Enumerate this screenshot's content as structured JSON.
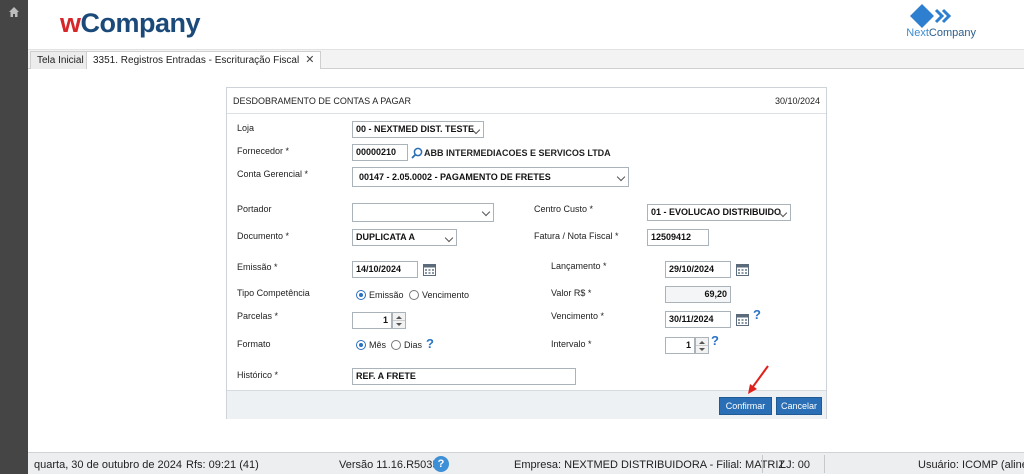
{
  "header": {
    "logo_w": "w",
    "logo_rest": "Company",
    "nc_next": "Next",
    "nc_company": "Company"
  },
  "tabs": [
    {
      "label": "Tela Inicial"
    },
    {
      "label": "3351. Registros Entradas - Escrituração Fiscal",
      "close": "✕"
    }
  ],
  "dialog": {
    "title": "DESDOBRAMENTO DE CONTAS A PAGAR",
    "date": "30/10/2024",
    "loja": {
      "label": "Loja",
      "value": "00 - NEXTMED DIST. TESTE"
    },
    "fornecedor": {
      "label": "Fornecedor *",
      "code": "00000210",
      "name": "ABB INTERMEDIACOES E SERVICOS LTDA"
    },
    "conta": {
      "label": "Conta Gerencial *",
      "value": "00147 - 2.05.0002 - PAGAMENTO DE FRETES"
    },
    "portador": {
      "label": "Portador",
      "value": ""
    },
    "centro_custo": {
      "label": "Centro Custo *",
      "value": "01 - EVOLUCAO DISTRIBUIDO"
    },
    "documento": {
      "label": "Documento *",
      "value": "DUPLICATA A"
    },
    "fatura": {
      "label": "Fatura / Nota Fiscal *",
      "value": "12509412"
    },
    "emissao": {
      "label": "Emissão *",
      "value": "14/10/2024"
    },
    "lancamento": {
      "label": "Lançamento *",
      "value": "29/10/2024"
    },
    "tipo_competencia": {
      "label": "Tipo Competência",
      "opt1": "Emissão",
      "opt2": "Vencimento"
    },
    "valor": {
      "label": "Valor R$ *",
      "value": "69,20"
    },
    "parcelas": {
      "label": "Parcelas *",
      "value": "1"
    },
    "vencimento": {
      "label": "Vencimento *",
      "value": "30/11/2024"
    },
    "formato": {
      "label": "Formato",
      "opt1": "Mês",
      "opt2": "Dias"
    },
    "intervalo": {
      "label": "Intervalo *",
      "value": "1"
    },
    "historico": {
      "label": "Histórico *",
      "value": "REF. A FRETE"
    },
    "confirm_label": "Confirmar",
    "cancel_label": "Cancelar"
  },
  "status": {
    "date": "quarta, 30 de outubro de 2024",
    "rfs": "Rfs: 09:21 (41)",
    "version": "Versão 11.16.R5035",
    "help": "?",
    "company": "Empresa: NEXTMED DISTRIBUIDORA - Filial: MATRIZ",
    "lj": "LJ: 00",
    "user": "Usuário: ICOMP (aline)"
  },
  "colors": {
    "primary": "#2a6fb5",
    "logo_red": "#d7262a",
    "logo_blue": "#1b4a7a",
    "arrow_red": "#e0201a"
  }
}
